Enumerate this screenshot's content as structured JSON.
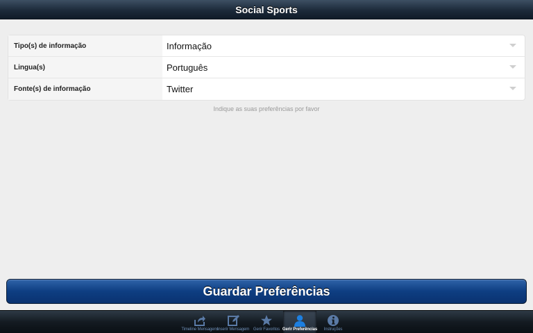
{
  "header": {
    "title": "Social Sports"
  },
  "form": {
    "rows": [
      {
        "label": "Tipo(s) de informação",
        "value": "Informação"
      },
      {
        "label": "Lingua(s)",
        "value": "Português"
      },
      {
        "label": "Fonte(s) de informação",
        "value": "Twitter"
      }
    ],
    "hint": "Indique as suas preferências por favor"
  },
  "save_button": {
    "label": "Guardar Preferências"
  },
  "tabbar": {
    "active_color": "#1d7fe0",
    "inactive_color": "#5a7aa6",
    "tabs": [
      {
        "label": "Timeline Mensagens",
        "icon": "share-icon",
        "active": false
      },
      {
        "label": "Inserir Mensagem",
        "icon": "compose-icon",
        "active": false
      },
      {
        "label": "Gerir Favoritos",
        "icon": "star-icon",
        "active": false
      },
      {
        "label": "Gerir Preferências",
        "icon": "user-icon",
        "active": true
      },
      {
        "label": "Instruções",
        "icon": "info-icon",
        "active": false
      }
    ]
  }
}
